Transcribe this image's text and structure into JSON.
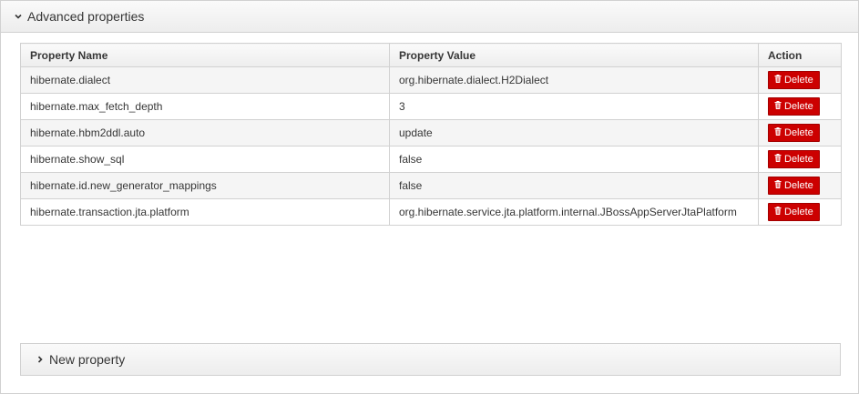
{
  "panel": {
    "title": "Advanced properties",
    "expanded_icon": "chevron-down-icon"
  },
  "table": {
    "headers": {
      "name": "Property Name",
      "value": "Property Value",
      "action": "Action"
    },
    "rows": [
      {
        "name": "hibernate.dialect",
        "value": "org.hibernate.dialect.H2Dialect",
        "action": "Delete"
      },
      {
        "name": "hibernate.max_fetch_depth",
        "value": "3",
        "action": "Delete"
      },
      {
        "name": "hibernate.hbm2ddl.auto",
        "value": "update",
        "action": "Delete"
      },
      {
        "name": "hibernate.show_sql",
        "value": "false",
        "action": "Delete"
      },
      {
        "name": "hibernate.id.new_generator_mappings",
        "value": "false",
        "action": "Delete"
      },
      {
        "name": "hibernate.transaction.jta.platform",
        "value": "org.hibernate.service.jta.platform.internal.JBossAppServerJtaPlatform",
        "action": "Delete"
      }
    ]
  },
  "new_property": {
    "label": "New property",
    "collapsed_icon": "chevron-right-icon"
  },
  "colors": {
    "delete_button": "#cc0000",
    "border": "#d1d1d1"
  }
}
